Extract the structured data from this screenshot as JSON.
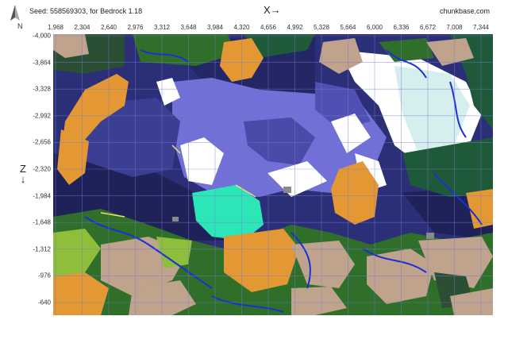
{
  "header": {
    "seed_text": "Seed: 558569303, for Bedrock 1.18",
    "x_axis_label": "X→",
    "brand": "chunkbase.com",
    "north_label": "N"
  },
  "axes": {
    "z_label": "Z",
    "z_arrow": "↓",
    "x_ticks": [
      "1,968",
      "2,304",
      "2,640",
      "2,976",
      "3,312",
      "3,648",
      "3,984",
      "4,320",
      "4,656",
      "4,992",
      "5,328",
      "5,664",
      "6,000",
      "6,336",
      "6,672",
      "7,008",
      "7,344"
    ],
    "z_ticks": [
      "-4,000",
      "-3,864",
      "-3,328",
      "-2,992",
      "-2,656",
      "-2,320",
      "-1,984",
      "-1,648",
      "-1,312",
      "-976",
      "-640"
    ]
  },
  "colors": {
    "deep_ocean": "#2b2f78",
    "deep_cold_ocean": "#222260",
    "ocean": "#3a3f93",
    "cold_ocean": "#4d4fb0",
    "frozen_ocean": "#7070d6",
    "deep_frozen": "#4a4aa8",
    "badlands": "#e39834",
    "forest": "#2f6f2a",
    "dark_forest": "#2b4f35",
    "plains": "#8fbf3a",
    "taiga": "#1e5a3a",
    "mountains": "#bfa38c",
    "snow": "#ffffff",
    "ice": "#d6eeee",
    "warm_ocean": "#2ce6b8",
    "river": "#1a2fd6",
    "beach": "#f0e070",
    "stone": "#8a8a8a",
    "grid": "#7a7ad0"
  },
  "map_layers": {
    "biomes": [
      "ocean",
      "deep ocean",
      "frozen ocean",
      "warm ocean",
      "badlands",
      "forest",
      "dark forest",
      "plains",
      "taiga",
      "mountains",
      "snowy plains",
      "ice spikes",
      "river",
      "beach"
    ]
  }
}
